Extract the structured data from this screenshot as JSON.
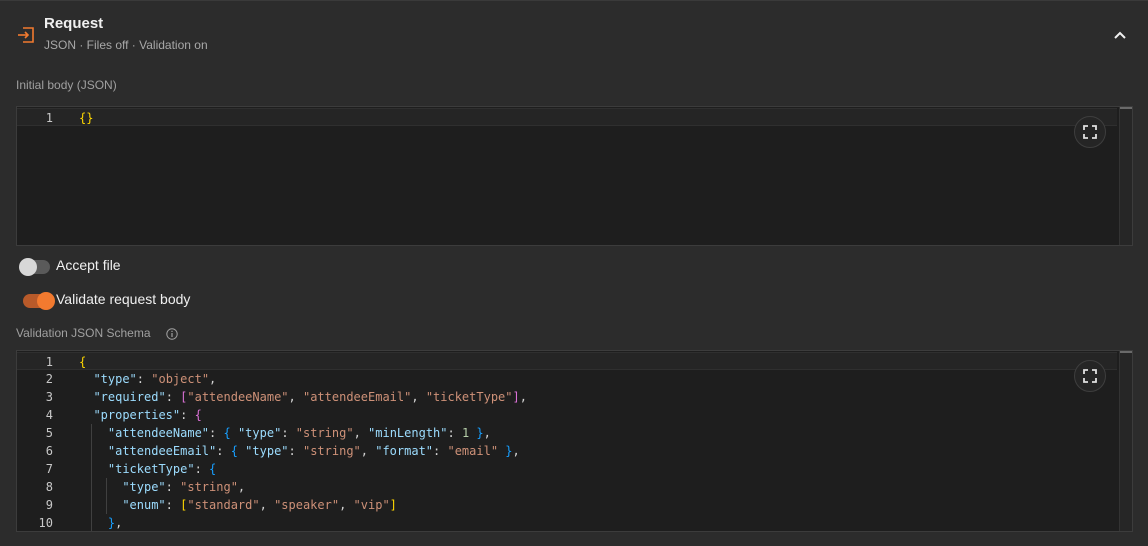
{
  "header": {
    "title": "Request",
    "subtitle": "JSON · Files off · Validation on",
    "icon": "enter-arrow-icon",
    "collapse_icon": "chevron-up-icon"
  },
  "initial_body": {
    "label": "Initial body (JSON)",
    "lines": [
      {
        "n": "1",
        "tokens": [
          {
            "t": "{}",
            "c": "b1"
          }
        ]
      }
    ]
  },
  "accept_file": {
    "label": "Accept file",
    "state": "off"
  },
  "validate_body": {
    "label": "Validate request body",
    "state": "on"
  },
  "schema": {
    "label": "Validation JSON Schema",
    "lines": [
      {
        "n": "1",
        "indent": 0,
        "tokens": [
          {
            "t": "{",
            "c": "b1"
          }
        ]
      },
      {
        "n": "2",
        "indent": 1,
        "tokens": [
          {
            "t": "\"type\"",
            "c": "key"
          },
          {
            "t": ": ",
            "c": "p"
          },
          {
            "t": "\"object\"",
            "c": "str"
          },
          {
            "t": ",",
            "c": "p"
          }
        ]
      },
      {
        "n": "3",
        "indent": 1,
        "tokens": [
          {
            "t": "\"required\"",
            "c": "key"
          },
          {
            "t": ": ",
            "c": "p"
          },
          {
            "t": "[",
            "c": "b2"
          },
          {
            "t": "\"attendeeName\"",
            "c": "str"
          },
          {
            "t": ", ",
            "c": "p"
          },
          {
            "t": "\"attendeeEmail\"",
            "c": "str"
          },
          {
            "t": ", ",
            "c": "p"
          },
          {
            "t": "\"ticketType\"",
            "c": "str"
          },
          {
            "t": "]",
            "c": "b2"
          },
          {
            "t": ",",
            "c": "p"
          }
        ]
      },
      {
        "n": "4",
        "indent": 1,
        "tokens": [
          {
            "t": "\"properties\"",
            "c": "key"
          },
          {
            "t": ": ",
            "c": "p"
          },
          {
            "t": "{",
            "c": "b2"
          }
        ]
      },
      {
        "n": "5",
        "indent": 2,
        "tokens": [
          {
            "t": "\"attendeeName\"",
            "c": "key"
          },
          {
            "t": ": ",
            "c": "p"
          },
          {
            "t": "{",
            "c": "b3"
          },
          {
            "t": " ",
            "c": "p"
          },
          {
            "t": "\"type\"",
            "c": "key"
          },
          {
            "t": ": ",
            "c": "p"
          },
          {
            "t": "\"string\"",
            "c": "str"
          },
          {
            "t": ", ",
            "c": "p"
          },
          {
            "t": "\"minLength\"",
            "c": "key"
          },
          {
            "t": ": ",
            "c": "p"
          },
          {
            "t": "1",
            "c": "num"
          },
          {
            "t": " ",
            "c": "p"
          },
          {
            "t": "}",
            "c": "b3"
          },
          {
            "t": ",",
            "c": "p"
          }
        ]
      },
      {
        "n": "6",
        "indent": 2,
        "tokens": [
          {
            "t": "\"attendeeEmail\"",
            "c": "key"
          },
          {
            "t": ": ",
            "c": "p"
          },
          {
            "t": "{",
            "c": "b3"
          },
          {
            "t": " ",
            "c": "p"
          },
          {
            "t": "\"type\"",
            "c": "key"
          },
          {
            "t": ": ",
            "c": "p"
          },
          {
            "t": "\"string\"",
            "c": "str"
          },
          {
            "t": ", ",
            "c": "p"
          },
          {
            "t": "\"format\"",
            "c": "key"
          },
          {
            "t": ": ",
            "c": "p"
          },
          {
            "t": "\"email\"",
            "c": "str"
          },
          {
            "t": " ",
            "c": "p"
          },
          {
            "t": "}",
            "c": "b3"
          },
          {
            "t": ",",
            "c": "p"
          }
        ]
      },
      {
        "n": "7",
        "indent": 2,
        "tokens": [
          {
            "t": "\"ticketType\"",
            "c": "key"
          },
          {
            "t": ": ",
            "c": "p"
          },
          {
            "t": "{",
            "c": "b3"
          }
        ]
      },
      {
        "n": "8",
        "indent": 3,
        "tokens": [
          {
            "t": "\"type\"",
            "c": "key"
          },
          {
            "t": ": ",
            "c": "p"
          },
          {
            "t": "\"string\"",
            "c": "str"
          },
          {
            "t": ",",
            "c": "p"
          }
        ]
      },
      {
        "n": "9",
        "indent": 3,
        "tokens": [
          {
            "t": "\"enum\"",
            "c": "key"
          },
          {
            "t": ": ",
            "c": "p"
          },
          {
            "t": "[",
            "c": "b1"
          },
          {
            "t": "\"standard\"",
            "c": "str"
          },
          {
            "t": ", ",
            "c": "p"
          },
          {
            "t": "\"speaker\"",
            "c": "str"
          },
          {
            "t": ", ",
            "c": "p"
          },
          {
            "t": "\"vip\"",
            "c": "str"
          },
          {
            "t": "]",
            "c": "b1"
          }
        ]
      },
      {
        "n": "10",
        "indent": 2,
        "tokens": [
          {
            "t": "}",
            "c": "b3"
          },
          {
            "t": ",",
            "c": "p"
          }
        ]
      }
    ]
  },
  "expand_icon": "expand-icon",
  "info_icon": "info-icon",
  "colors": {
    "accent": "#f27a2f",
    "key": "#9cdcfe",
    "string": "#ce9178",
    "number": "#b5cea8",
    "bracket1": "#ffd700",
    "bracket2": "#da70d6",
    "bracket3": "#179fff"
  }
}
